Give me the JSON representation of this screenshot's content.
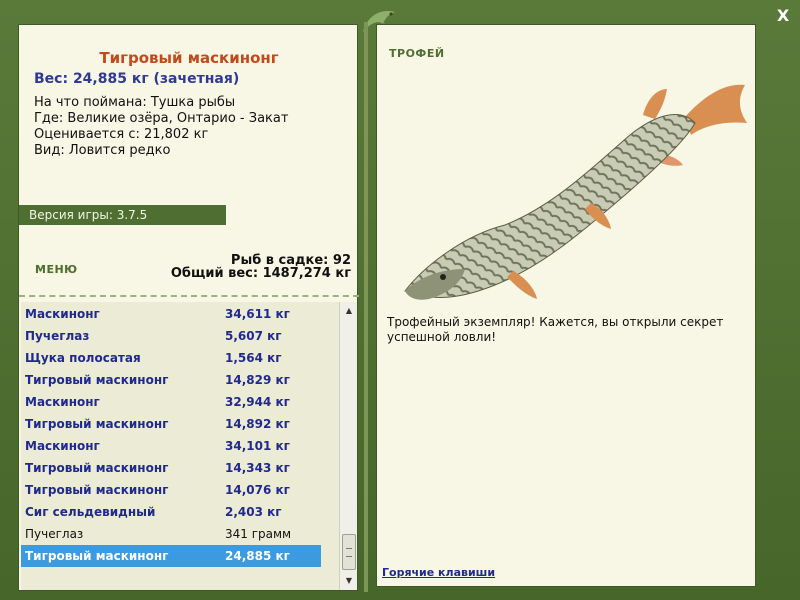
{
  "fish": {
    "title": "Тигровый маскинонг",
    "weight": "Вес: 24,885 кг (зачетная)",
    "caught": "На что поймана: Тушка рыбы",
    "where": "Где: Великие озёра, Онтарио - Закат",
    "value": "Оценивается с: 21,802 кг",
    "kind": "Вид: Ловится редко"
  },
  "version": "Версия игры: 3.7.5",
  "menu": {
    "label": "МЕНЮ"
  },
  "keepnet": {
    "count": "Рыб в садке: 92",
    "total": "Общий вес: 1487,274 кг"
  },
  "list": [
    {
      "name": "Маскинонг",
      "weight": "34,611 кг",
      "style": "bold"
    },
    {
      "name": "Пучеглаз",
      "weight": "5,607 кг",
      "style": "bold"
    },
    {
      "name": "Щука полосатая",
      "weight": "1,564 кг",
      "style": "bold"
    },
    {
      "name": "Тигровый маскинонг",
      "weight": "14,829 кг",
      "style": "bold"
    },
    {
      "name": "Маскинонг",
      "weight": "32,944 кг",
      "style": "bold"
    },
    {
      "name": "Тигровый маскинонг",
      "weight": "14,892 кг",
      "style": "bold"
    },
    {
      "name": "Маскинонг",
      "weight": "34,101 кг",
      "style": "bold"
    },
    {
      "name": "Тигровый маскинонг",
      "weight": "14,343 кг",
      "style": "bold"
    },
    {
      "name": "Тигровый маскинонг",
      "weight": "14,076 кг",
      "style": "bold"
    },
    {
      "name": "Сиг сельдевидный",
      "weight": "2,403 кг",
      "style": "bold"
    },
    {
      "name": "Пучеглаз",
      "weight": "341 грамм",
      "style": "plain"
    },
    {
      "name": "Тигровый маскинонг",
      "weight": "24,885 кг",
      "style": "selected"
    }
  ],
  "trophy": {
    "label": "ТРОФЕЙ",
    "text": "Трофейный экземпляр! Кажется, вы открыли секрет успешной ловли!"
  },
  "hotkeys": "Горячие клавиши",
  "close": "X",
  "icons": {
    "close": "close-icon",
    "logo": "fish-logo-icon",
    "scroll_up": "chevron-up-icon",
    "scroll_down": "chevron-down-icon"
  },
  "colors": {
    "frame": "#4f6f32",
    "panel": "#f8f6e4",
    "title": "#c04a1a",
    "fish_name": "#1f2a8c",
    "selected": "#3b9ae0"
  }
}
